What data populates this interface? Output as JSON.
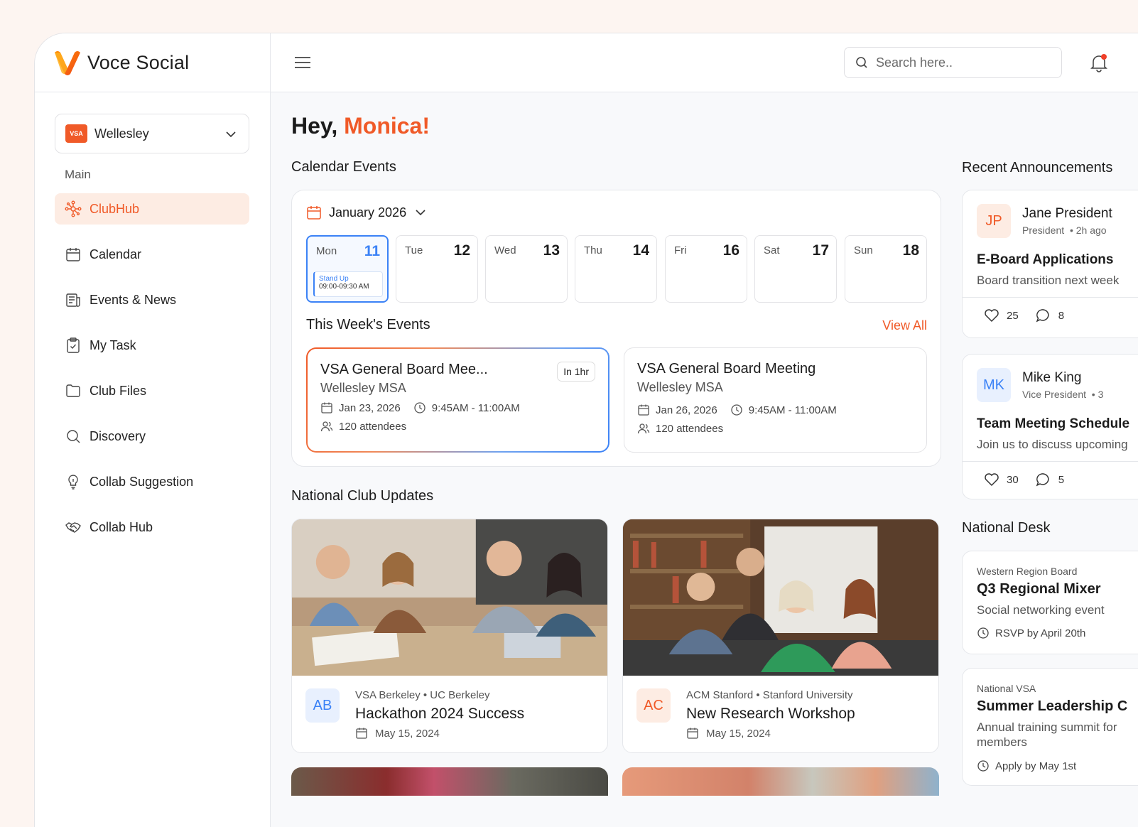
{
  "app": {
    "name": "Voce Social"
  },
  "club_selector": {
    "badge": "VSA",
    "name": "Wellesley"
  },
  "sidebar": {
    "section_label": "Main",
    "items": [
      {
        "label": "ClubHub",
        "icon": "hub-icon",
        "active": true
      },
      {
        "label": "Calendar",
        "icon": "calendar-icon"
      },
      {
        "label": "Events & News",
        "icon": "news-icon"
      },
      {
        "label": "My Task",
        "icon": "clipboard-check-icon"
      },
      {
        "label": "Club Files",
        "icon": "folder-icon"
      },
      {
        "label": "Discovery",
        "icon": "search-icon"
      },
      {
        "label": "Collab Suggestion",
        "icon": "lightbulb-icon"
      },
      {
        "label": "Collab Hub",
        "icon": "handshake-icon"
      }
    ]
  },
  "topbar": {
    "search_placeholder": "Search here..",
    "has_notification": true
  },
  "greeting": {
    "prefix": "Hey, ",
    "name": "Monica!"
  },
  "calendar": {
    "section_title": "Calendar Events",
    "month": "January 2026",
    "days": [
      {
        "name": "Mon",
        "num": "11",
        "selected": true
      },
      {
        "name": "Tue",
        "num": "12"
      },
      {
        "name": "Wed",
        "num": "13"
      },
      {
        "name": "Thu",
        "num": "14"
      },
      {
        "name": "Fri",
        "num": "16"
      },
      {
        "name": "Sat",
        "num": "17"
      },
      {
        "name": "Sun",
        "num": "18"
      }
    ],
    "selected_event": {
      "title": "Stand Up",
      "time": "09:00-09:30 AM"
    },
    "week_title": "This Week's Events",
    "view_all": "View All",
    "events": [
      {
        "title": "VSA General Board Mee...",
        "location": "Wellesley MSA",
        "date": "Jan 23, 2026",
        "time": "9:45AM - 11:00AM",
        "attendees": "120 attendees",
        "badge": "In 1hr"
      },
      {
        "title": "VSA General Board Meeting",
        "location": "Wellesley MSA",
        "date": "Jan 26, 2026",
        "time": "9:45AM - 11:00AM",
        "attendees": "120 attendees"
      }
    ]
  },
  "national_updates": {
    "section_title": "National Club Updates",
    "items": [
      {
        "initials": "AB",
        "org": "VSA Berkeley • UC Berkeley",
        "title": "Hackathon 2024 Success",
        "date": "May 15, 2024"
      },
      {
        "initials": "AC",
        "org": "ACM Stanford • Stanford University",
        "title": "New Research Workshop",
        "date": "May 15, 2024"
      }
    ]
  },
  "announcements": {
    "section_title": "Recent Announcements",
    "items": [
      {
        "initials": "JP",
        "name": "Jane President",
        "role": "President",
        "time": "• 2h ago",
        "title": "E-Board Applications",
        "body": "Board transition next week",
        "likes": "25",
        "comments": "8"
      },
      {
        "initials": "MK",
        "name": "Mike King",
        "role": "Vice President",
        "time": "• 3",
        "title": "Team Meeting Schedule",
        "body": "Join us to discuss upcoming",
        "likes": "30",
        "comments": "5"
      }
    ]
  },
  "national_desk": {
    "section_title": "National Desk",
    "items": [
      {
        "source": "Western Region Board",
        "title": "Q3 Regional Mixer",
        "body": "Social networking event",
        "footer": "RSVP by April 20th"
      },
      {
        "source": "National VSA",
        "title": "Summer Leadership C",
        "body": "Annual training summit for",
        "body2": "members",
        "footer": "Apply by May 1st"
      }
    ]
  },
  "colors": {
    "accent": "#f05a28",
    "blue": "#3b82f6",
    "text": "#1c1c1c"
  }
}
